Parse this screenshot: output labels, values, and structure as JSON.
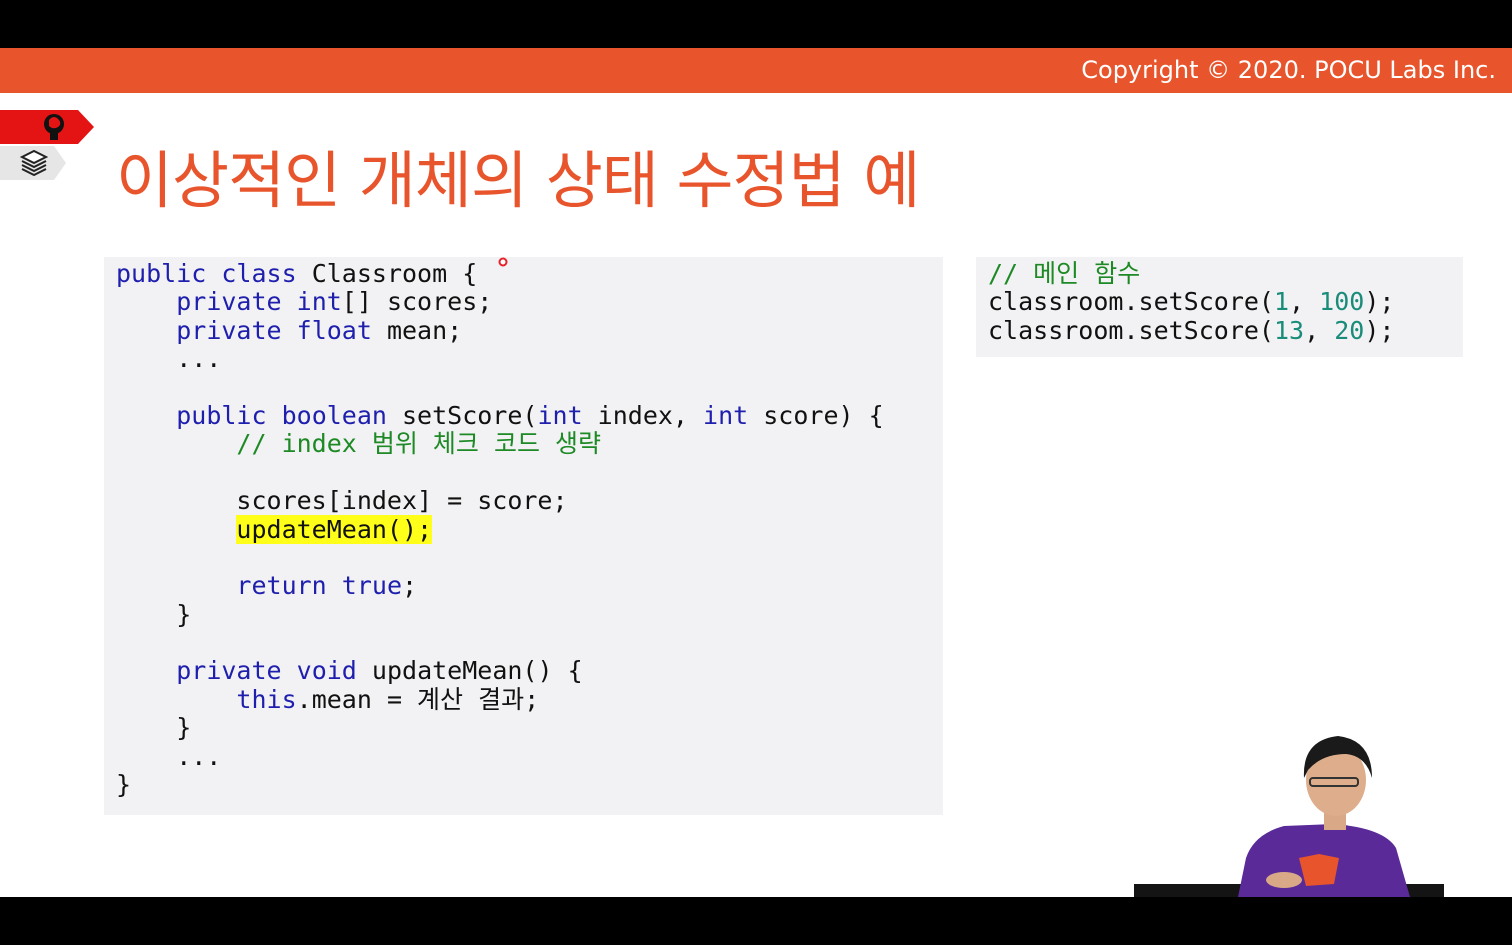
{
  "header": {
    "copyright": "Copyright © 2020. POCU Labs Inc."
  },
  "slide": {
    "title": "이상적인 개체의 상태 수정법 예"
  },
  "code_main": {
    "line_01": [
      "public",
      " ",
      "class",
      " Classroom {"
    ],
    "line_02": [
      "    ",
      "private",
      " ",
      "int",
      "[] scores;"
    ],
    "line_03": [
      "    ",
      "private",
      " ",
      "float",
      " mean;"
    ],
    "line_04": "    ...",
    "line_06": [
      "    ",
      "public",
      " ",
      "boolean",
      " setScore(",
      "int",
      " index, ",
      "int",
      " score) {"
    ],
    "line_07": [
      "        ",
      "// index 범위 체크 코드 생략"
    ],
    "line_09": "        scores[index] = score;",
    "line_10": [
      "        ",
      "updateMean();"
    ],
    "line_12": [
      "        ",
      "return",
      " ",
      "true",
      ";"
    ],
    "line_13": "    }",
    "line_15": [
      "    ",
      "private",
      " ",
      "void",
      " updateMean() {"
    ],
    "line_16": [
      "        ",
      "this",
      ".mean = 계산 결과;"
    ],
    "line_17": "    }",
    "line_18": "    ...",
    "line_19": "}"
  },
  "code_side": {
    "comment": "// 메인 함수",
    "call_1": [
      "classroom.setScore(",
      "1",
      ", ",
      "100",
      ");"
    ],
    "call_2": [
      "classroom.setScore(",
      "13",
      ", ",
      "20",
      ");"
    ]
  },
  "colors": {
    "accent": "#e8552c",
    "keyword": "#1f1fae",
    "comment": "#1e8a25",
    "number": "#1a8c7a",
    "highlight": "#ffff1a",
    "code_background": "#f2f2f4"
  },
  "icons": [
    "brain-head-icon",
    "stacked-layers-icon",
    "laser-pointer-dot"
  ]
}
